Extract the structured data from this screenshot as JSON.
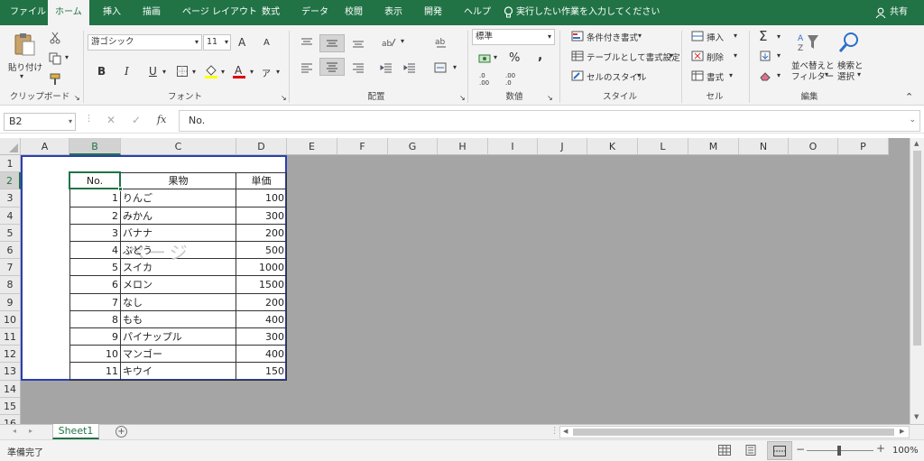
{
  "tabs": [
    "ファイル",
    "ホーム",
    "挿入",
    "描画",
    "ページ レイアウト",
    "数式",
    "データ",
    "校閲",
    "表示",
    "開発",
    "ヘルプ"
  ],
  "tell_me": "実行したい作業を入力してください",
  "share": "共有",
  "clipboard": {
    "paste": "貼り付け",
    "group": "クリップボード"
  },
  "font": {
    "name": "游ゴシック",
    "size": "11",
    "group": "フォント",
    "bold": "B",
    "italic": "I",
    "underline": "U",
    "color_a": "A",
    "grow": "A",
    "shrink": "A"
  },
  "alignment": {
    "group": "配置"
  },
  "number": {
    "format": "標準",
    "percent": "%",
    "comma": ",",
    "group": "数値",
    "inc_dec": ".0 .00",
    "dec_dec": ".00 .0"
  },
  "styles": {
    "conditional": "条件付き書式",
    "table": "テーブルとして書式設定",
    "cell_styles": "セルのスタイル",
    "group": "スタイル"
  },
  "cells": {
    "insert": "挿入",
    "delete": "削除",
    "format": "書式",
    "group": "セル"
  },
  "editing": {
    "sort_line1": "並べ替えと",
    "sort_line2": "フィルター",
    "find_line1": "検索と",
    "find_line2": "選択",
    "group": "編集",
    "sigma": "Σ"
  },
  "formula_bar": {
    "name_box": "B2",
    "fx": "fx",
    "value": "No."
  },
  "columns": [
    "A",
    "B",
    "C",
    "D",
    "E",
    "F",
    "G",
    "H",
    "I",
    "J",
    "K",
    "L",
    "M",
    "N",
    "O",
    "P"
  ],
  "rows": [
    "1",
    "2",
    "3",
    "4",
    "5",
    "6",
    "7",
    "8",
    "9",
    "10",
    "11",
    "12",
    "13",
    "14",
    "15",
    "16"
  ],
  "table": {
    "headers": [
      "No.",
      "果物",
      "単価"
    ],
    "rows": [
      [
        "1",
        "りんご",
        "100"
      ],
      [
        "2",
        "みかん",
        "300"
      ],
      [
        "3",
        "バナナ",
        "200"
      ],
      [
        "4",
        "ぶどう",
        "500"
      ],
      [
        "5",
        "スイカ",
        "1000"
      ],
      [
        "6",
        "メロン",
        "1500"
      ],
      [
        "7",
        "なし",
        "200"
      ],
      [
        "8",
        "もも",
        "400"
      ],
      [
        "9",
        "パイナップル",
        "300"
      ],
      [
        "10",
        "マンゴー",
        "400"
      ],
      [
        "11",
        "キウイ",
        "150"
      ]
    ]
  },
  "page_watermark": "ページ",
  "sheet_tab": "Sheet1",
  "status": {
    "ready": "準備完了",
    "zoom": "100%"
  },
  "colors": {
    "accent": "#217346",
    "page_border": "#2b3fb3",
    "outside": "#a5a5a5"
  }
}
